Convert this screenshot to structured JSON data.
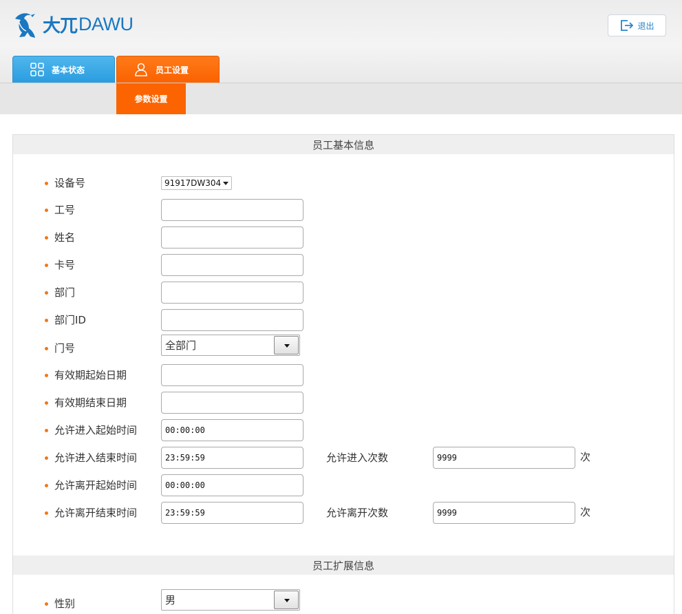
{
  "brand": {
    "logo_cn": "大兀",
    "logo_en": "DAWU",
    "brand_color": "#1a78c2"
  },
  "header": {
    "logout_label": "退出",
    "logout_icon": "logout-icon"
  },
  "tabs": [
    {
      "label": "基本状态",
      "icon": "grid-icon",
      "color": "#2a9de0"
    },
    {
      "label": "员工设置",
      "icon": "user-icon",
      "color": "#fb6200",
      "active": true
    }
  ],
  "subtabs": [
    {
      "label": "参数设置",
      "active": true
    }
  ],
  "sections": {
    "basic_title": "员工基本信息",
    "ext_title": "员工扩展信息"
  },
  "fields": {
    "device_label": "设备号",
    "device_value": "91917DW304",
    "emp_id_label": "工号",
    "emp_id_value": "",
    "name_label": "姓名",
    "name_value": "",
    "card_label": "卡号",
    "card_value": "",
    "dept_label": "部门",
    "dept_value": "",
    "dept_id_label": "部门ID",
    "dept_id_value": "",
    "door_label": "门号",
    "door_value": "全部门",
    "valid_start_label": "有效期起始日期",
    "valid_start_value": "",
    "valid_end_label": "有效期结束日期",
    "valid_end_value": "",
    "enter_start_label": "允许进入起始时间",
    "enter_start_value": "00:00:00",
    "enter_end_label": "允许进入结束时间",
    "enter_end_value": "23:59:59",
    "enter_count_label": "允许进入次数",
    "enter_count_value": "9999",
    "enter_count_unit": "次",
    "leave_start_label": "允许离开起始时间",
    "leave_start_value": "00:00:00",
    "leave_end_label": "允许离开结束时间",
    "leave_end_value": "23:59:59",
    "leave_count_label": "允许离开次数",
    "leave_count_value": "9999",
    "leave_count_unit": "次",
    "gender_label": "性别",
    "gender_value": "男"
  },
  "colors": {
    "accent_orange": "#fb6400",
    "accent_blue": "#2a9de0",
    "bullet": "#f07818"
  }
}
